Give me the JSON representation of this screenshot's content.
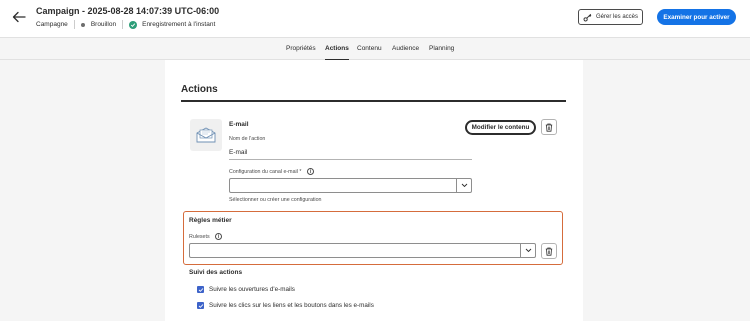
{
  "header": {
    "title": "Campaign - 2025-08-28 14:07:39 UTC-06:00",
    "type_label": "Campagne",
    "status_label": "Brouillon",
    "save_status": "Enregistrement à l'instant",
    "manage_access_label": "Gérer les accès",
    "review_label": "Examiner pour activer"
  },
  "tabs": [
    {
      "label": "Propriétés"
    },
    {
      "label": "Actions",
      "active": true
    },
    {
      "label": "Contenu"
    },
    {
      "label": "Audience"
    },
    {
      "label": "Planning"
    }
  ],
  "actions": {
    "heading": "Actions",
    "email": {
      "title": "E-mail",
      "name_label": "Nom de l'action",
      "name_value": "E-mail",
      "modify_label": "Modifier le contenu",
      "config_label": "Configuration du canal e-mail",
      "config_required": "*",
      "config_value": "",
      "config_help": "Sélectionner ou créer une configuration"
    },
    "business_rules": {
      "title": "Règles métier",
      "ruleset_label": "Rulesets",
      "ruleset_value": ""
    },
    "tracking": {
      "title": "Suivi des actions",
      "items": [
        {
          "label": "Suivre les ouvertures d'e-mails",
          "checked": true
        },
        {
          "label": "Suivre les clics sur les liens et les boutons dans les e-mails",
          "checked": true
        }
      ]
    }
  },
  "icons": {
    "back": "arrow-left-icon",
    "status_dot": "status-dot-icon",
    "saved": "checkmark-circle-icon",
    "access": "key-icon",
    "email": "envelope-icon",
    "delete": "trash-icon",
    "dropdown": "chevron-down-icon",
    "info": "info-icon"
  },
  "colors": {
    "primary": "#1473e6",
    "saved": "#2d9d78",
    "highlight_border": "#d56c3c",
    "checkbox": "#3d63c9"
  }
}
